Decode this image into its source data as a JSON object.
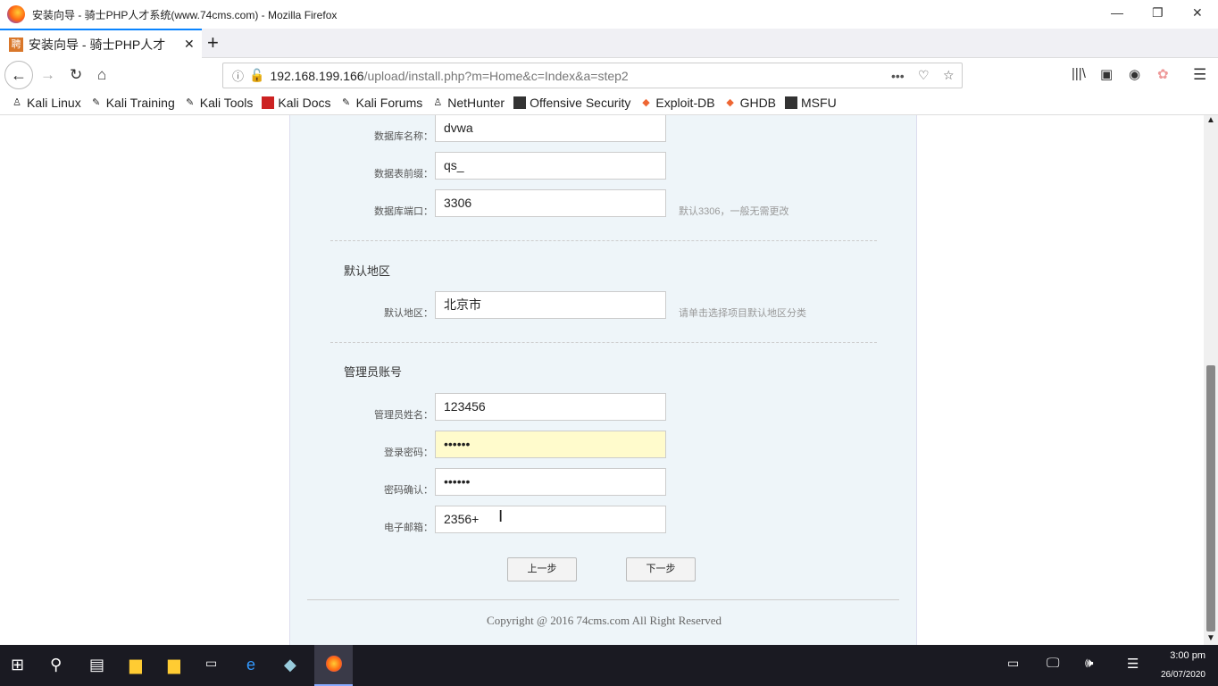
{
  "window": {
    "title": "安装向导 - 骑士PHP人才系统(www.74cms.com) - Mozilla Firefox"
  },
  "tab": {
    "label": "安装向导 - 骑士PHP人才",
    "favicon": "聘"
  },
  "url": {
    "host": "192.168.199.166",
    "path": "/upload/install.php?m=Home&c=Index&a=step2"
  },
  "bookmarks": [
    "Kali Linux",
    "Kali Training",
    "Kali Tools",
    "Kali Docs",
    "Kali Forums",
    "NetHunter",
    "Offensive Security",
    "Exploit-DB",
    "GHDB",
    "MSFU"
  ],
  "form": {
    "db_name": {
      "label": "数据库名称：",
      "value": "dvwa"
    },
    "db_prefix": {
      "label": "数据表前缀：",
      "value": "qs_"
    },
    "db_port": {
      "label": "数据库端口：",
      "value": "3306",
      "hint": "默认3306，一般无需更改"
    },
    "region_section": "默认地区",
    "region": {
      "label": "默认地区：",
      "value": "北京市",
      "hint": "请单击选择项目默认地区分类"
    },
    "admin_section": "管理员账号",
    "admin_name": {
      "label": "管理员姓名：",
      "value": "123456"
    },
    "password": {
      "label": "登录密码：",
      "value": "••••••"
    },
    "password_confirm": {
      "label": "密码确认：",
      "value": "••••••"
    },
    "email": {
      "label": "电子邮箱：",
      "value": "2356+"
    },
    "prev": "上一步",
    "next": "下一步"
  },
  "footer": {
    "copyright": "Copyright @ 2016 74cms.com All Right Reserved"
  },
  "taskbar": {
    "time": "3:00 pm",
    "date": "26/07/2020"
  }
}
